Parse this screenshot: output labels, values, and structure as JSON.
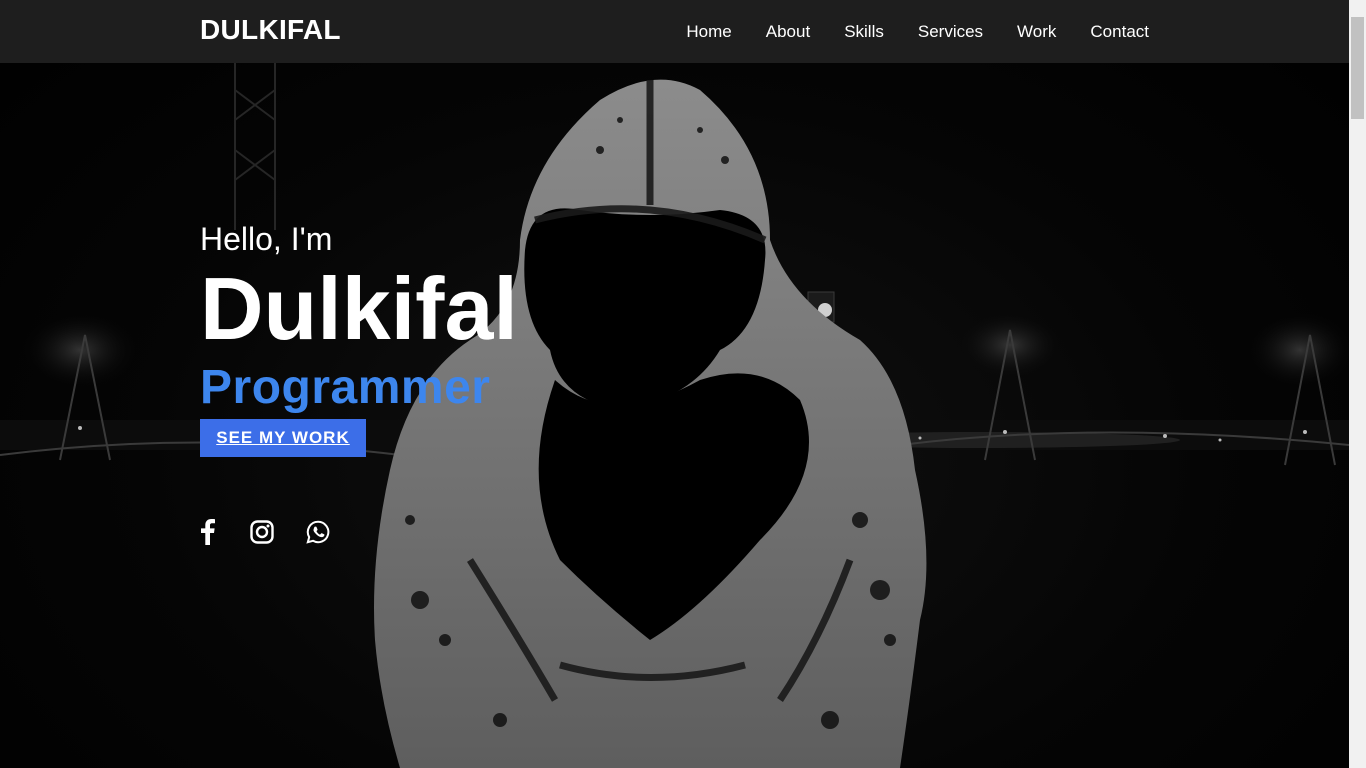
{
  "brand": {
    "name": "DULKIFAL"
  },
  "nav": {
    "items": [
      {
        "label": "Home"
      },
      {
        "label": "About"
      },
      {
        "label": "Skills"
      },
      {
        "label": "Services"
      },
      {
        "label": "Work"
      },
      {
        "label": "Contact"
      }
    ]
  },
  "hero": {
    "greeting": "Hello, I'm",
    "name": "Dulkifal",
    "role": "Programmer",
    "cta_label": "SEE MY WORK"
  },
  "socials": [
    {
      "icon": "facebook-icon"
    },
    {
      "icon": "instagram-icon"
    },
    {
      "icon": "whatsapp-icon"
    }
  ],
  "colors": {
    "navbar_bg": "#1e1e1e",
    "accent_role": "#3d86ee",
    "cta_bg": "#3c6ee8",
    "page_bg": "#000000"
  }
}
